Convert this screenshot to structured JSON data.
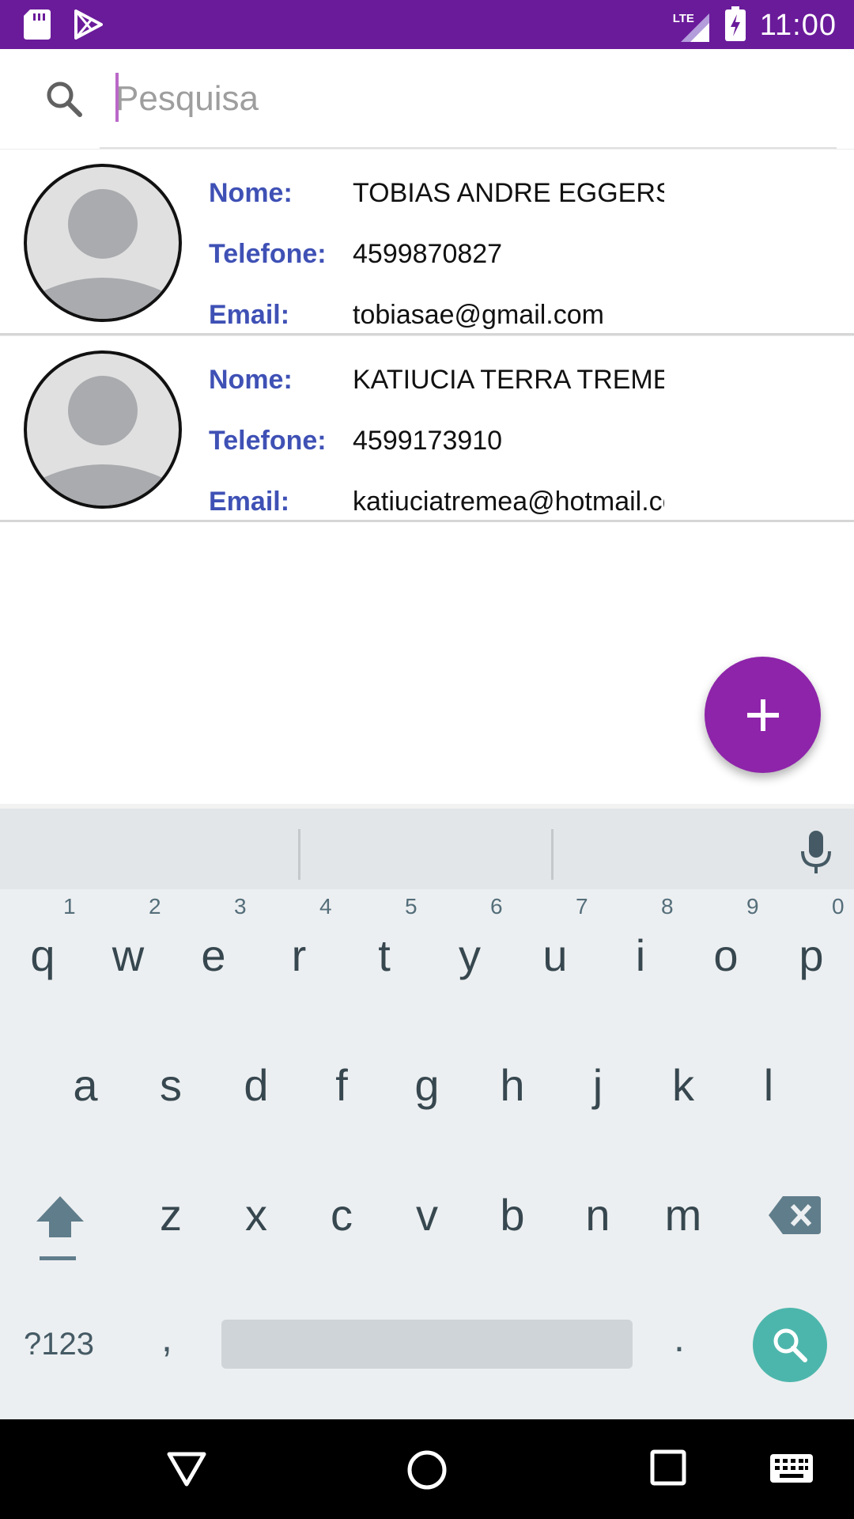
{
  "status_bar": {
    "time": "11:00",
    "network_label": "LTE",
    "icons": [
      "sd-card-icon",
      "play-store-icon",
      "signal-icon",
      "battery-charging-icon"
    ]
  },
  "search": {
    "placeholder": "Pesquisa",
    "value": "",
    "icon": "search-icon"
  },
  "contacts": [
    {
      "name_label": "Nome:",
      "name": "TOBIAS ANDRE EGGERS",
      "phone_label": "Telefone:",
      "phone": "4599870827",
      "email_label": "Email:",
      "email": "tobiasae@gmail.com"
    },
    {
      "name_label": "Nome:",
      "name": "KATIUCIA TERRA TREMEA",
      "phone_label": "Telefone:",
      "phone": "4599173910",
      "email_label": "Email:",
      "email": "katiuciatremea@hotmail.com"
    }
  ],
  "fab": {
    "label": "+",
    "icon": "plus-icon"
  },
  "keyboard": {
    "row1": [
      "q",
      "w",
      "e",
      "r",
      "t",
      "y",
      "u",
      "i",
      "o",
      "p"
    ],
    "row1_hints": [
      "1",
      "2",
      "3",
      "4",
      "5",
      "6",
      "7",
      "8",
      "9",
      "0"
    ],
    "row2": [
      "a",
      "s",
      "d",
      "f",
      "g",
      "h",
      "j",
      "k",
      "l"
    ],
    "row3": [
      "z",
      "x",
      "c",
      "v",
      "b",
      "n",
      "m"
    ],
    "symbols_label": "?123",
    "comma": ",",
    "period": ".",
    "action_icon": "search-icon"
  },
  "colors": {
    "status_bar": "#6a1b9a",
    "fab": "#8e24aa",
    "label_blue": "#3f51b5",
    "keyboard_action": "#4db6ac"
  }
}
